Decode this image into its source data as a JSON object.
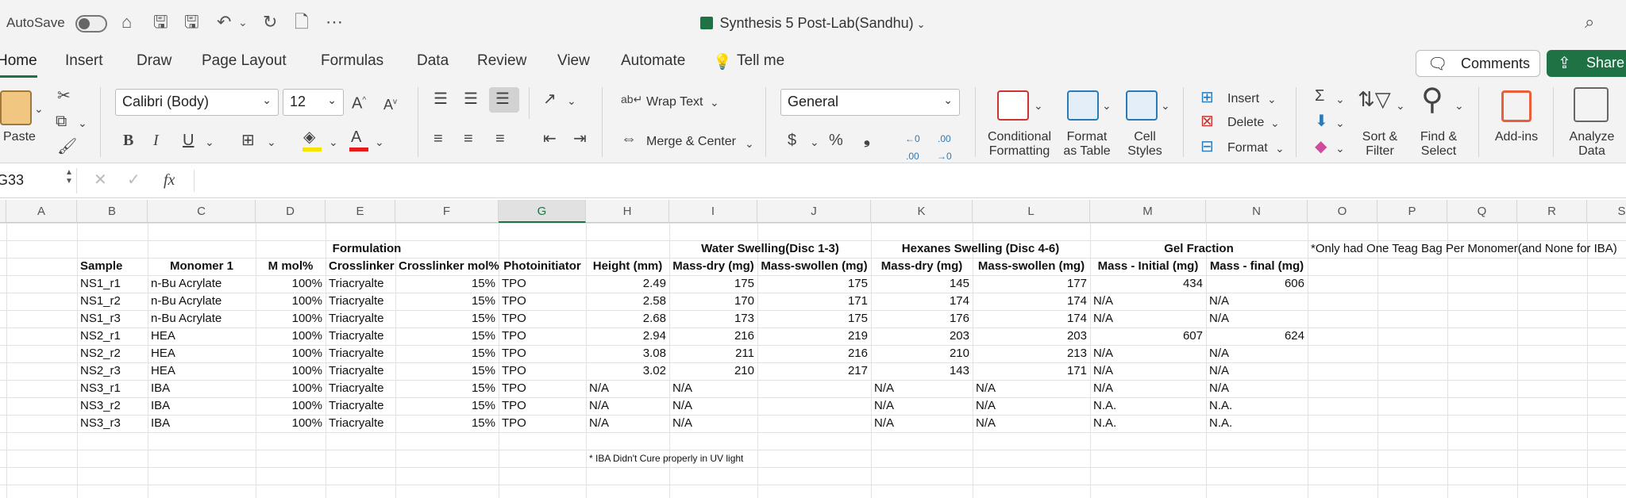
{
  "titlebar": {
    "autosave_label": "AutoSave",
    "document_title": "Synthesis 5 Post-Lab(Sandhu)"
  },
  "tabs": [
    "Home",
    "Insert",
    "Draw",
    "Page Layout",
    "Formulas",
    "Data",
    "Review",
    "View",
    "Automate"
  ],
  "tell_me": "Tell me",
  "comments_label": "Comments",
  "share_label": "Share",
  "ribbon": {
    "paste": "Paste",
    "font_name": "Calibri (Body)",
    "font_size": "12",
    "wrap_text": "Wrap Text",
    "merge_center": "Merge & Center",
    "number_format": "General",
    "conditional_formatting": [
      "Conditional",
      "Formatting"
    ],
    "format_as_table": [
      "Format",
      "as Table"
    ],
    "cell_styles": [
      "Cell",
      "Styles"
    ],
    "insert": "Insert",
    "delete": "Delete",
    "format": "Format",
    "sort_filter": [
      "Sort &",
      "Filter"
    ],
    "find_select": [
      "Find &",
      "Select"
    ],
    "add_ins": "Add-ins",
    "analyze_data": [
      "Analyze",
      "Data"
    ]
  },
  "formula_bar": {
    "name_box": "G33",
    "fx": "fx",
    "content": ""
  },
  "columns": [
    "A",
    "B",
    "C",
    "D",
    "E",
    "F",
    "G",
    "H",
    "I",
    "J",
    "K",
    "L",
    "M",
    "N",
    "O",
    "P",
    "Q",
    "R",
    "S"
  ],
  "selected_column": "G",
  "sheet": {
    "group_headers": {
      "formulation": "Formulation",
      "water": "Water Swelling(Disc 1-3)",
      "hexanes": "Hexanes Swelling (Disc 4-6)",
      "gel": "Gel Fraction",
      "note": "*Only had One Teag Bag Per Monomer(and None for IBA)"
    },
    "headers": [
      "Sample",
      "Monomer 1",
      "M mol%",
      "Crosslinker",
      "Crosslinker mol%",
      "Photoinitiator",
      "Height (mm)",
      "Mass-dry (mg)",
      "Mass-swollen (mg)",
      "Mass-dry (mg)",
      "Mass-swollen (mg)",
      "Mass - Initial (mg)",
      "Mass - final (mg)"
    ],
    "rows": [
      [
        "NS1_r1",
        "n-Bu Acrylate",
        "100%",
        "Triacryalte",
        "15%",
        "TPO",
        "2.49",
        "175",
        "175",
        "145",
        "177",
        "434",
        "606"
      ],
      [
        "NS1_r2",
        "n-Bu Acrylate",
        "100%",
        "Triacryalte",
        "15%",
        "TPO",
        "2.58",
        "170",
        "171",
        "174",
        "174",
        "N/A",
        "N/A"
      ],
      [
        "NS1_r3",
        "n-Bu Acrylate",
        "100%",
        "Triacryalte",
        "15%",
        "TPO",
        "2.68",
        "173",
        "175",
        "176",
        "174",
        "N/A",
        "N/A"
      ],
      [
        "NS2_r1",
        "HEA",
        "100%",
        "Triacryalte",
        "15%",
        "TPO",
        "2.94",
        "216",
        "219",
        "203",
        "203",
        "607",
        "624"
      ],
      [
        "NS2_r2",
        "HEA",
        "100%",
        "Triacryalte",
        "15%",
        "TPO",
        "3.08",
        "211",
        "216",
        "210",
        "213",
        "N/A",
        "N/A"
      ],
      [
        "NS2_r3",
        "HEA",
        "100%",
        "Triacryalte",
        "15%",
        "TPO",
        "3.02",
        "210",
        "217",
        "143",
        "171",
        "N/A",
        "N/A"
      ],
      [
        "NS3_r1",
        "IBA",
        "100%",
        "Triacryalte",
        "15%",
        "TPO",
        "N/A",
        "N/A",
        "",
        "N/A",
        "N/A",
        "N/A",
        "N/A"
      ],
      [
        "NS3_r2",
        "IBA",
        "100%",
        "Triacryalte",
        "15%",
        "TPO",
        "N/A",
        "N/A",
        "",
        "N/A",
        "N/A",
        "N.A.",
        "N.A."
      ],
      [
        "NS3_r3",
        "IBA",
        "100%",
        "Triacryalte",
        "15%",
        "TPO",
        "N/A",
        "N/A",
        "",
        "N/A",
        "N/A",
        "N.A.",
        "N.A."
      ]
    ],
    "footnote": "* IBA Didn't Cure properly in UV light"
  }
}
